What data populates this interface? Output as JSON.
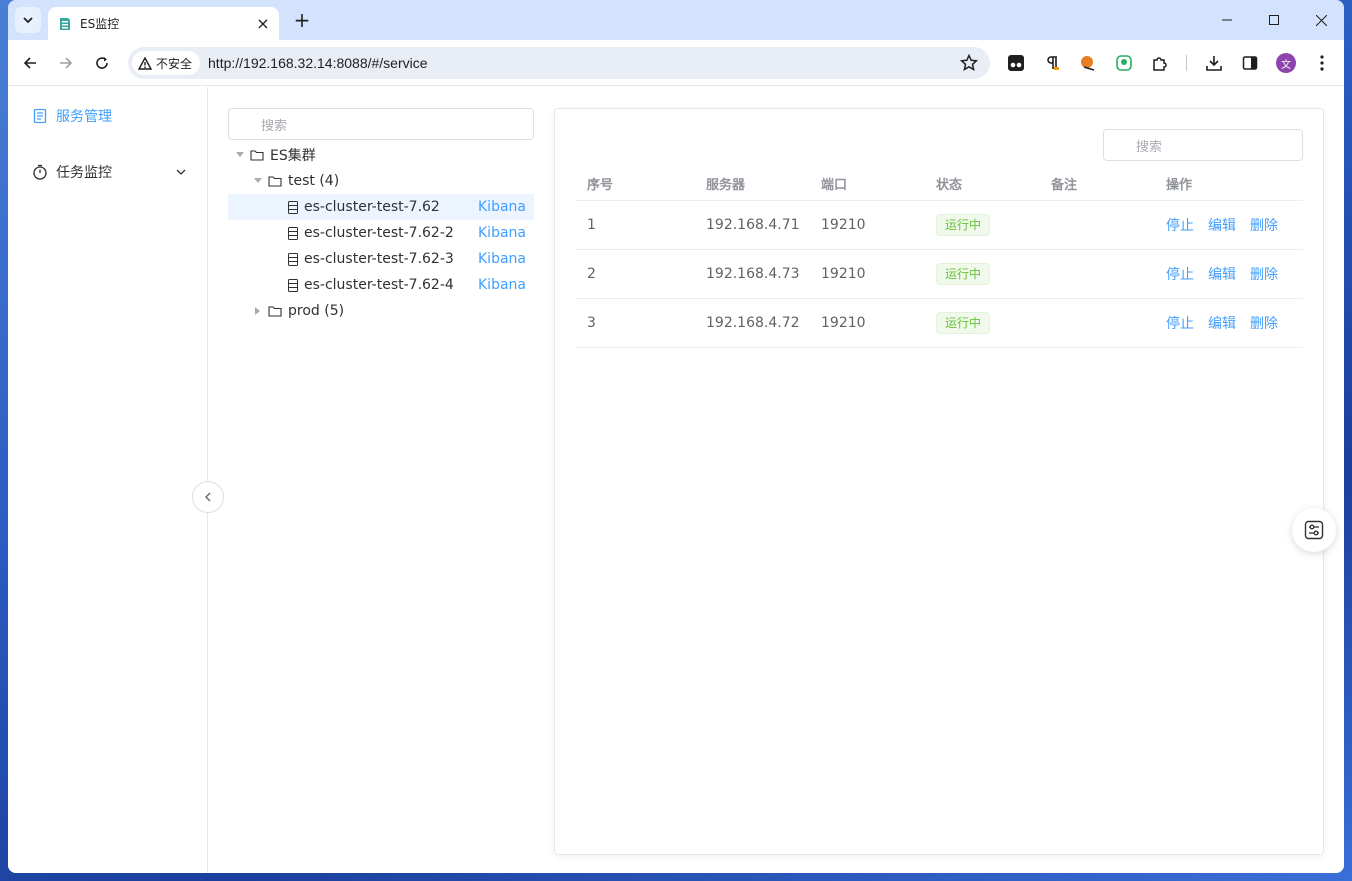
{
  "browser": {
    "tab_title": "ES监控",
    "security_label": "不安全",
    "url": "http://192.168.32.14:8088/#/service",
    "avatar_letter": "文",
    "accent": "#409eff"
  },
  "sidebar": {
    "items": [
      {
        "label": "服务管理",
        "icon": "document-icon",
        "active": true
      },
      {
        "label": "任务监控",
        "icon": "timer-icon",
        "active": false
      }
    ]
  },
  "tree": {
    "search_placeholder": "搜索",
    "root_label": "ES集群",
    "group_test": "test (4)",
    "group_prod": "prod (5)",
    "nodes": [
      {
        "label": "es-cluster-test-7.62",
        "link": "Kibana"
      },
      {
        "label": "es-cluster-test-7.62-2",
        "link": "Kibana"
      },
      {
        "label": "es-cluster-test-7.62-3",
        "link": "Kibana"
      },
      {
        "label": "es-cluster-test-7.62-4",
        "link": "Kibana"
      }
    ]
  },
  "table": {
    "search_placeholder": "搜索",
    "headers": [
      "序号",
      "服务器",
      "端口",
      "状态",
      "备注",
      "操作"
    ],
    "rows": [
      {
        "index": "1",
        "server": "192.168.4.71",
        "port": "19210",
        "status": "运行中",
        "remark": ""
      },
      {
        "index": "2",
        "server": "192.168.4.73",
        "port": "19210",
        "status": "运行中",
        "remark": ""
      },
      {
        "index": "3",
        "server": "192.168.4.72",
        "port": "19210",
        "status": "运行中",
        "remark": ""
      }
    ],
    "actions": {
      "stop": "停止",
      "edit": "编辑",
      "delete": "删除"
    }
  }
}
